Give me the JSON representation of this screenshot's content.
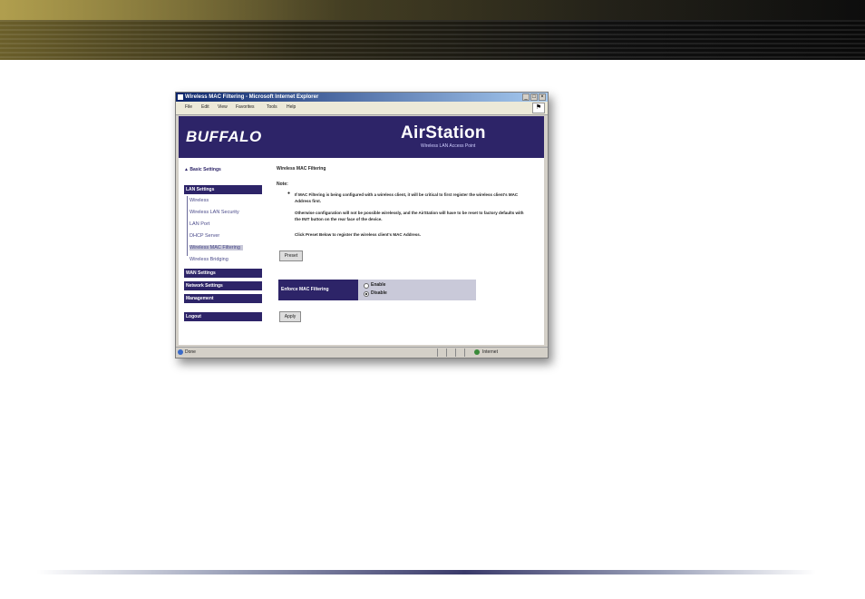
{
  "browser": {
    "title": "Wireless MAC Filtering - Microsoft Internet Explorer",
    "menu": [
      "File",
      "Edit",
      "View",
      "Favorites",
      "Tools",
      "Help"
    ],
    "status": "Done",
    "zone": "Internet"
  },
  "header": {
    "brand": "BUFFALO",
    "product": "AirStation",
    "subtitle": "Wireless LAN Access Point"
  },
  "sidebar": {
    "basic_settings": "Basic Settings",
    "lan_settings": "LAN Settings",
    "lan_items": [
      "Wireless",
      "Wireless LAN Security",
      "LAN Port",
      "DHCP Server",
      "Wireless MAC Filtering",
      "Wireless Bridging"
    ],
    "wan_settings": "WAN Settings",
    "network_settings": "Network Settings",
    "management": "Management",
    "logout": "Logout"
  },
  "main": {
    "title": "Wireless MAC Filtering",
    "note_label": "Note:",
    "para1": "If MAC Filtering is being configured with a wireless client, it will be critical to first register the wireless client's MAC Address first.",
    "para2": "Otherwise configuration will not be possible wirelessly, and the AirStation will have to be reset to factory defaults with the INIT button on the rear face of the device.",
    "para3": "Click Preset Below to register the wireless client's MAC Address.",
    "preset_button": "Preset",
    "mac_filter_label": "Enforce MAC Filtering",
    "option_enable": "Enable",
    "option_disable": "Disable",
    "selected_option": "Disable",
    "apply_button": "Apply"
  },
  "colors": {
    "header_bg": "#2d2468",
    "section_bg": "#2d2468",
    "link": "#4a4a8a"
  }
}
